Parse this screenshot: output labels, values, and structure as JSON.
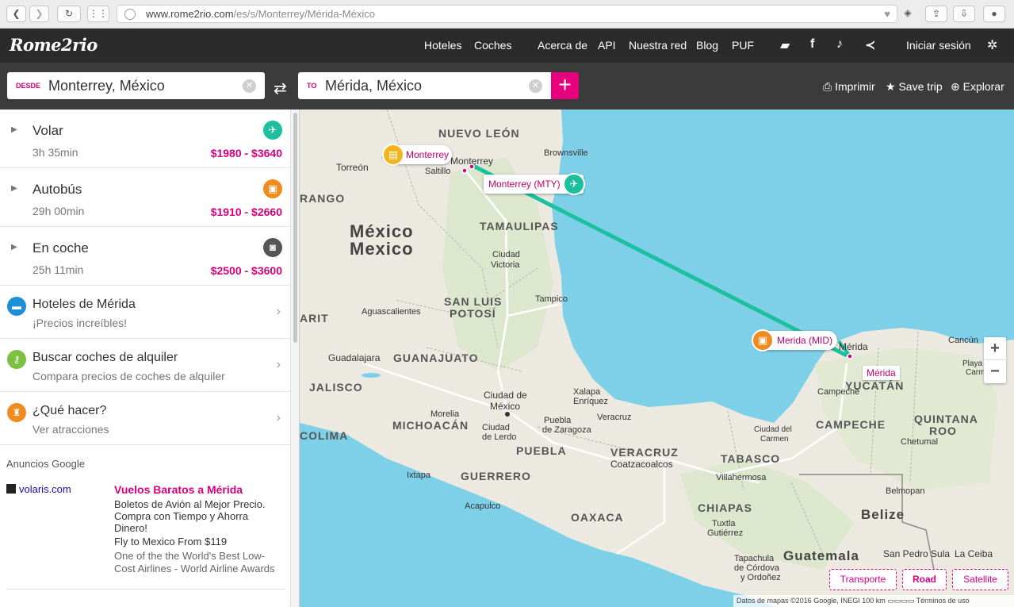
{
  "browser": {
    "url_host": "www.rome2rio.com",
    "url_path": "/es/s/Monterrey/Mérida-México"
  },
  "nav": {
    "logo": "Rome2rio",
    "links": [
      "Hoteles",
      "Coches",
      "Acerca de",
      "API",
      "Nuestra red",
      "Blog",
      "PUF"
    ],
    "signin": "Iniciar sesión"
  },
  "search": {
    "from_tag": "DESDE",
    "from_value": "Monterrey, México",
    "to_tag": "TO",
    "to_value": "Mérida, México",
    "tools": [
      "Imprimir",
      "Save trip",
      "Explorar"
    ]
  },
  "routes": [
    {
      "name": "Volar",
      "duration": "3h 35min",
      "price": "$1980 - $3640",
      "icon": "plane-icon",
      "color": "#1dbf9e"
    },
    {
      "name": "Autobús",
      "duration": "29h 00min",
      "price": "$1910 - $2660",
      "icon": "bus-icon",
      "color": "#f08b1d"
    },
    {
      "name": "En coche",
      "duration": "25h 11min",
      "price": "$2500 - $3600",
      "icon": "car-icon",
      "color": "#555555"
    }
  ],
  "promos": [
    {
      "title": "Hoteles de Mérida",
      "subtitle": "¡Precios increíbles!",
      "icon": "bed-icon",
      "color": "#1d8fd6"
    },
    {
      "title": "Buscar coches de alquiler",
      "subtitle": "Compara precios de coches de alquiler",
      "icon": "key-icon",
      "color": "#7cc142"
    },
    {
      "title": "¿Qué hacer?",
      "subtitle": "Ver atracciones",
      "icon": "castle-icon",
      "color": "#f08b1d"
    }
  ],
  "ads": {
    "heading": "Anuncios Google",
    "source": "volaris.com",
    "title": "Vuelos Baratos a Mérida",
    "lines": [
      "Boletos de Avión al Mejor Precio.",
      "Compra con Tiempo y Ahorra",
      "Dinero!",
      "Fly to Mexico From $119",
      "One of the the World's Best Low-",
      "Cost Airlines - World Airline Awards"
    ]
  },
  "map": {
    "pins": {
      "monterrey": "Monterrey",
      "mty": "Monterrey (MTY)",
      "mid": "Merida (MID)",
      "merida": "Mérida"
    },
    "labels": {
      "nuevo_leon": "NUEVO LEÓN",
      "brownsville": "Brownsville",
      "torreon": "Torreón",
      "monterrey_city": "Monterrey",
      "saltillo": "Saltillo",
      "durango": "RANGO",
      "tamaulipas": "TAMAULIPAS",
      "mexico_es": "México",
      "mexico_en": "Mexico",
      "ciudad_victoria_1": "Ciudad",
      "ciudad_victoria_2": "Victoria",
      "san_luis_1": "SAN LUIS",
      "san_luis_2": "POTOSÍ",
      "tampico": "Tampico",
      "nayarit": "ARIT",
      "aguascalientes": "Aguascalientes",
      "guadalajara": "Guadalajara",
      "guanajuato": "GUANAJUATO",
      "jalisco": "JALISCO",
      "cdmx_1": "Ciudad de",
      "cdmx_2": "México",
      "xalapa_1": "Xalapa",
      "xalapa_2": "Enríquez",
      "veracruz_city": "Veracruz",
      "morelia": "Morelia",
      "michoacan": "MICHOACÁN",
      "colima": "COLIMA",
      "lerdo_1": "Ciudad",
      "lerdo_2": "de Lerdo",
      "puebla_1": "Puebla",
      "puebla_2": "de Zaragoza",
      "puebla_state": "PUEBLA",
      "veracruz_state": "VERACRUZ",
      "coatza": "Coatzacoalcos",
      "tabasco": "TABASCO",
      "villahermosa": "Villahermosa",
      "merida_city": "Mérida",
      "cancun": "Cancún",
      "playa_1": "Playa del",
      "playa_2": "Carmen",
      "campeche_city": "Campeche",
      "yucatan": "YUCATÁN",
      "campeche_state": "CAMPECHE",
      "carmen_1": "Ciudad del",
      "carmen_2": "Carmen",
      "qroo_1": "QUINTANA",
      "qroo_2": "ROO",
      "chetumal": "Chetumal",
      "ixtapa": "Ixtapa",
      "guerrero": "GUERRERO",
      "acapulco": "Acapulco",
      "oaxaca": "OAXACA",
      "chiapas": "CHIAPAS",
      "belmopan": "Belmopan",
      "belize": "Belize",
      "tuxtla_1": "Tuxtla",
      "tuxtla_2": "Gutiérrez",
      "guatemala": "Guatemala",
      "sps": "San Pedro Sula",
      "ceiba": "La Ceiba",
      "tapachula": "Tapachula",
      "cordova_1": "de Córdova",
      "cordova_2": "y Ordoñez"
    },
    "map_types": [
      "Transporte",
      "Road",
      "Satellite"
    ],
    "attribution": "Datos de mapas ©2016 Google, INEGI    100 km ▭▭▭▭    Términos de uso"
  }
}
